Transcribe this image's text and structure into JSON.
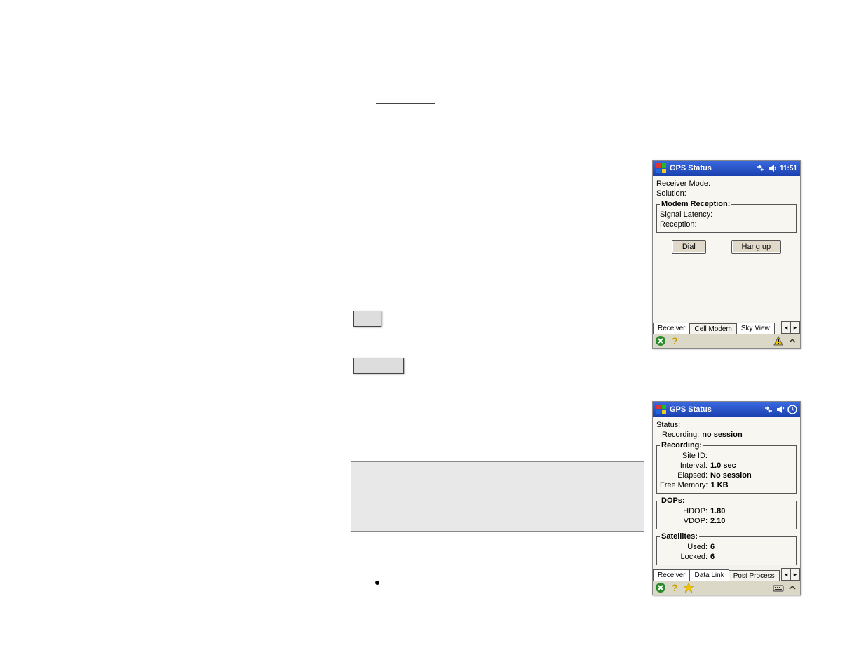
{
  "device1": {
    "title": "GPS Status",
    "time": "11:51",
    "receiver_mode_lbl": "Receiver Mode:",
    "solution_lbl": "Solution:",
    "modem_group": "Modem Reception:",
    "signal_latency_lbl": "Signal Latency:",
    "reception_lbl": "Reception:",
    "dial": "Dial",
    "hangup": "Hang up",
    "tabs": {
      "receiver": "Receiver",
      "cell": "Cell Modem",
      "sky": "Sky View"
    }
  },
  "device2": {
    "title": "GPS Status",
    "status_lbl": "Status:",
    "recording_lbl": "Recording:",
    "recording_val": "no session",
    "rec_group": "Recording:",
    "site_id_lbl": "Site ID:",
    "site_id_val": "",
    "interval_lbl": "Interval:",
    "interval_val": "1.0 sec",
    "elapsed_lbl": "Elapsed:",
    "elapsed_val": "No session",
    "freemem_lbl": "Free Memory:",
    "freemem_val": "1 KB",
    "dops_group": "DOPs:",
    "hdop_lbl": "HDOP:",
    "hdop_val": "1.80",
    "vdop_lbl": "VDOP:",
    "vdop_val": "2.10",
    "sat_group": "Satellites:",
    "used_lbl": "Used:",
    "used_val": "6",
    "locked_lbl": "Locked:",
    "locked_val": "6",
    "tabs": {
      "receiver": "Receiver",
      "datalink": "Data Link",
      "post": "Post Process"
    }
  }
}
